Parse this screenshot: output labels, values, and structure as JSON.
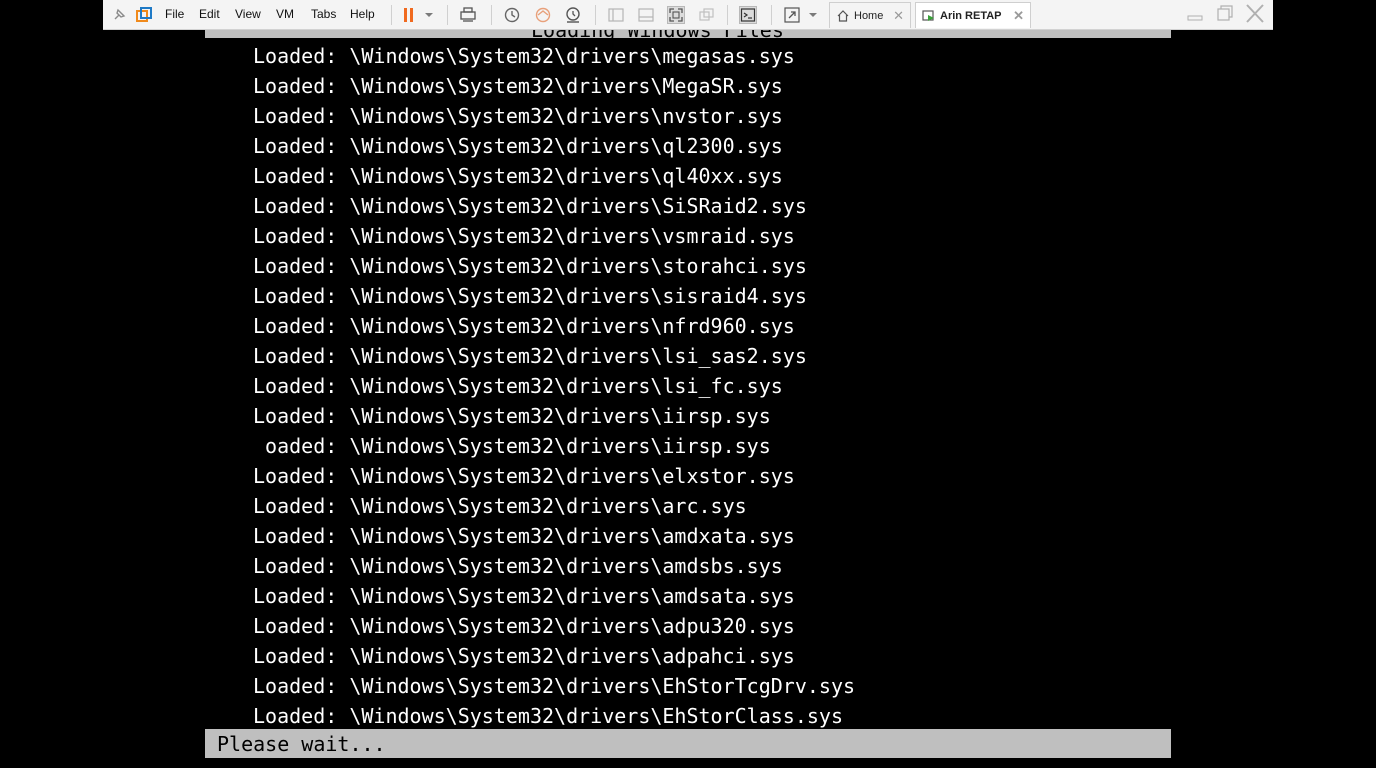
{
  "toolbar": {
    "menus": [
      "File",
      "Edit",
      "View",
      "VM",
      "Tabs",
      "Help"
    ]
  },
  "tabs": [
    {
      "label": "Home",
      "active": false
    },
    {
      "label": "Arin RETAP",
      "active": true
    }
  ],
  "console": {
    "header_partial": "Loading Windows Files",
    "lines": [
      "Loaded: \\Windows\\System32\\drivers\\megasas.sys",
      "Loaded: \\Windows\\System32\\drivers\\MegaSR.sys",
      "Loaded: \\Windows\\System32\\drivers\\nvstor.sys",
      "Loaded: \\Windows\\System32\\drivers\\ql2300.sys",
      "Loaded: \\Windows\\System32\\drivers\\ql40xx.sys",
      "Loaded: \\Windows\\System32\\drivers\\SiSRaid2.sys",
      "Loaded: \\Windows\\System32\\drivers\\vsmraid.sys",
      "Loaded: \\Windows\\System32\\drivers\\storahci.sys",
      "Loaded: \\Windows\\System32\\drivers\\sisraid4.sys",
      "Loaded: \\Windows\\System32\\drivers\\nfrd960.sys",
      "Loaded: \\Windows\\System32\\drivers\\lsi_sas2.sys",
      "Loaded: \\Windows\\System32\\drivers\\lsi_fc.sys",
      "Loaded: \\Windows\\System32\\drivers\\iirsp.sys",
      " oaded: \\Windows\\System32\\drivers\\iirsp.sys",
      "Loaded: \\Windows\\System32\\drivers\\elxstor.sys",
      "Loaded: \\Windows\\System32\\drivers\\arc.sys",
      "Loaded: \\Windows\\System32\\drivers\\amdxata.sys",
      "Loaded: \\Windows\\System32\\drivers\\amdsbs.sys",
      "Loaded: \\Windows\\System32\\drivers\\amdsata.sys",
      "Loaded: \\Windows\\System32\\drivers\\adpu320.sys",
      "Loaded: \\Windows\\System32\\drivers\\adpahci.sys",
      "Loaded: \\Windows\\System32\\drivers\\EhStorTcgDrv.sys",
      "Loaded: \\Windows\\System32\\drivers\\EhStorClass.sys"
    ],
    "status": "Please wait..."
  },
  "colors": {
    "toolbar_bg": "#f4f4f4",
    "console_bg": "#000000",
    "console_fg": "#ffffff",
    "status_bar_bg": "#bfbfbf",
    "pause_accent": "#f06a1f"
  }
}
